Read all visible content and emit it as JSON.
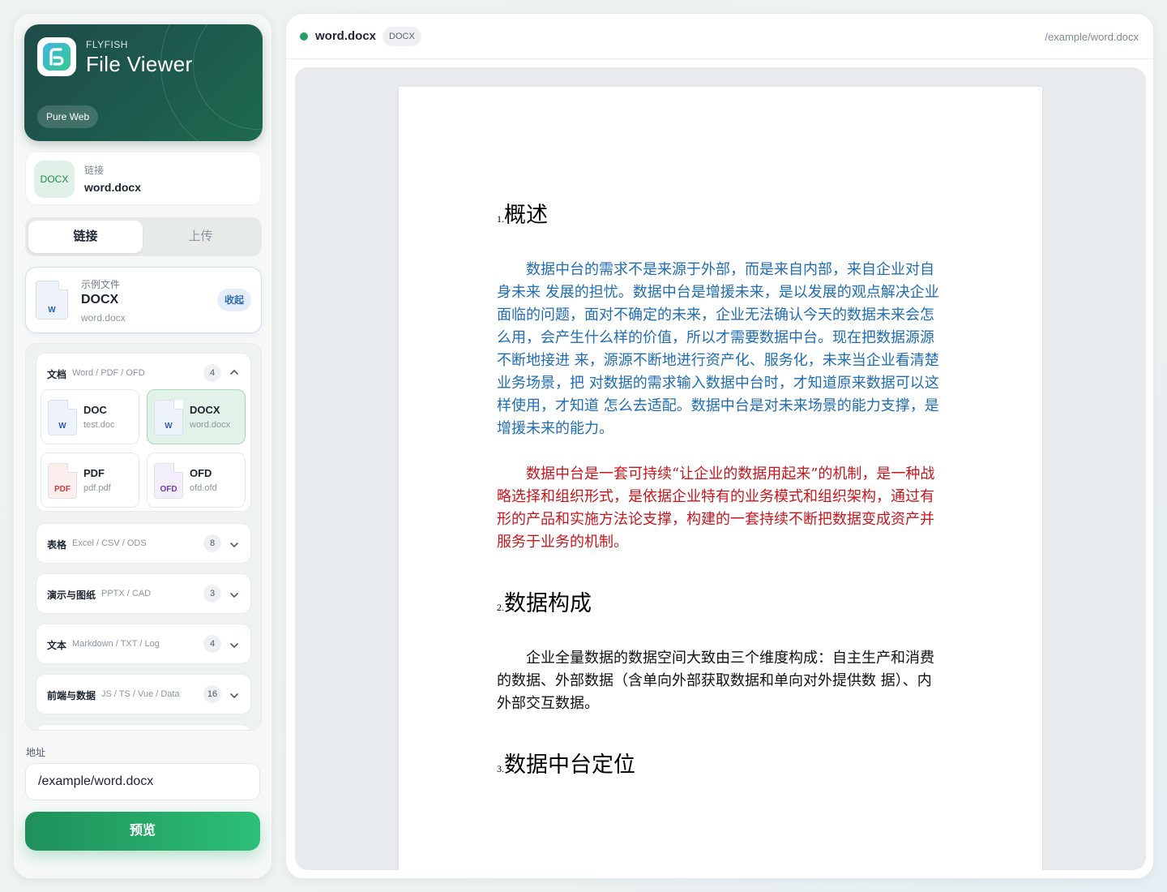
{
  "brand": {
    "kicker": "FLYFISH",
    "title": "File Viewer",
    "badge": "Pure Web"
  },
  "current_file": {
    "tag": "DOCX",
    "label": "链接",
    "value": "word.docx"
  },
  "source_tabs": {
    "link": "链接",
    "upload": "上传",
    "active": "链接"
  },
  "sample": {
    "kicker": "示例文件",
    "name": "DOCX",
    "file": "word.docx",
    "icon_ext": "W",
    "collapse_label": "收起"
  },
  "groups": [
    {
      "title": "文档",
      "subtitle": "Word / PDF / OFD",
      "count": "4",
      "expanded": true,
      "items": [
        {
          "name": "DOC",
          "file": "test.doc",
          "ext": "W",
          "ext_color": "#2f5db0",
          "icon_bg": "#eef3fb",
          "active": false
        },
        {
          "name": "DOCX",
          "file": "word.docx",
          "ext": "W",
          "ext_color": "#2f5db0",
          "icon_bg": "#eef3fb",
          "active": true
        },
        {
          "name": "PDF",
          "file": "pdf.pdf",
          "ext": "PDF",
          "ext_color": "#d0393b",
          "icon_bg": "#fdeeee",
          "active": false
        },
        {
          "name": "OFD",
          "file": "ofd.ofd",
          "ext": "OFD",
          "ext_color": "#6b3db0",
          "icon_bg": "#f3eefb",
          "active": false
        }
      ]
    },
    {
      "title": "表格",
      "subtitle": "Excel / CSV / ODS",
      "count": "8",
      "expanded": false
    },
    {
      "title": "演示与图纸",
      "subtitle": "PPTX / CAD",
      "count": "3",
      "expanded": false
    },
    {
      "title": "文本",
      "subtitle": "Markdown / TXT / Log",
      "count": "4",
      "expanded": false
    },
    {
      "title": "前端与数据",
      "subtitle": "JS / TS / Vue / Data",
      "count": "16",
      "expanded": false
    }
  ],
  "address": {
    "label": "地址",
    "value": "/example/word.docx"
  },
  "preview_button": "预览",
  "viewer": {
    "file_name": "word.docx",
    "file_type": "DOCX",
    "file_path": "/example/word.docx",
    "status_color": "#25a064"
  },
  "document": {
    "sections": [
      {
        "num": "1.",
        "title": "概述"
      },
      {
        "num": "2.",
        "title": "数据构成"
      },
      {
        "num": "3.",
        "title": "数据中台定位"
      }
    ],
    "para1": "数据中台的需求不是来源于外部，而是来自内部，来自企业对自身未来 发展的担忧。数据中台是增援未来，是以发展的观点解决企业面临的问题，面对不确定的未来，企业无法确认今天的数据未来会怎么用，会产生什么样的价值，所以才需要数据中台。现在把数据源源不断地接进 来，源源不断地进行资产化、服务化，未来当企业看清楚业务场景，把 对数据的需求输入数据中台时，才知道原来数据可以这样使用，才知道 怎么去适配。数据中台是对未来场景的能力支撑，是增援未来的能力。",
    "para2": "数据中台是一套可持续“让企业的数据用起来”的机制，是一种战略选择和组织形式，是依据企业特有的业务模式和组织架构，通过有形的产品和实施方法论支撑，构建的一套持续不断把数据变成资产并服务于业务的机制。",
    "para3": "企业全量数据的数据空间大致由三个维度构成：自主生产和消费的数据、外部数据（含单向外部获取数据和单向对外提供数 据）、内外部交互数据。",
    "colors": {
      "blue": "#1f6db5",
      "red": "#c8161d",
      "black": "#111111"
    }
  }
}
